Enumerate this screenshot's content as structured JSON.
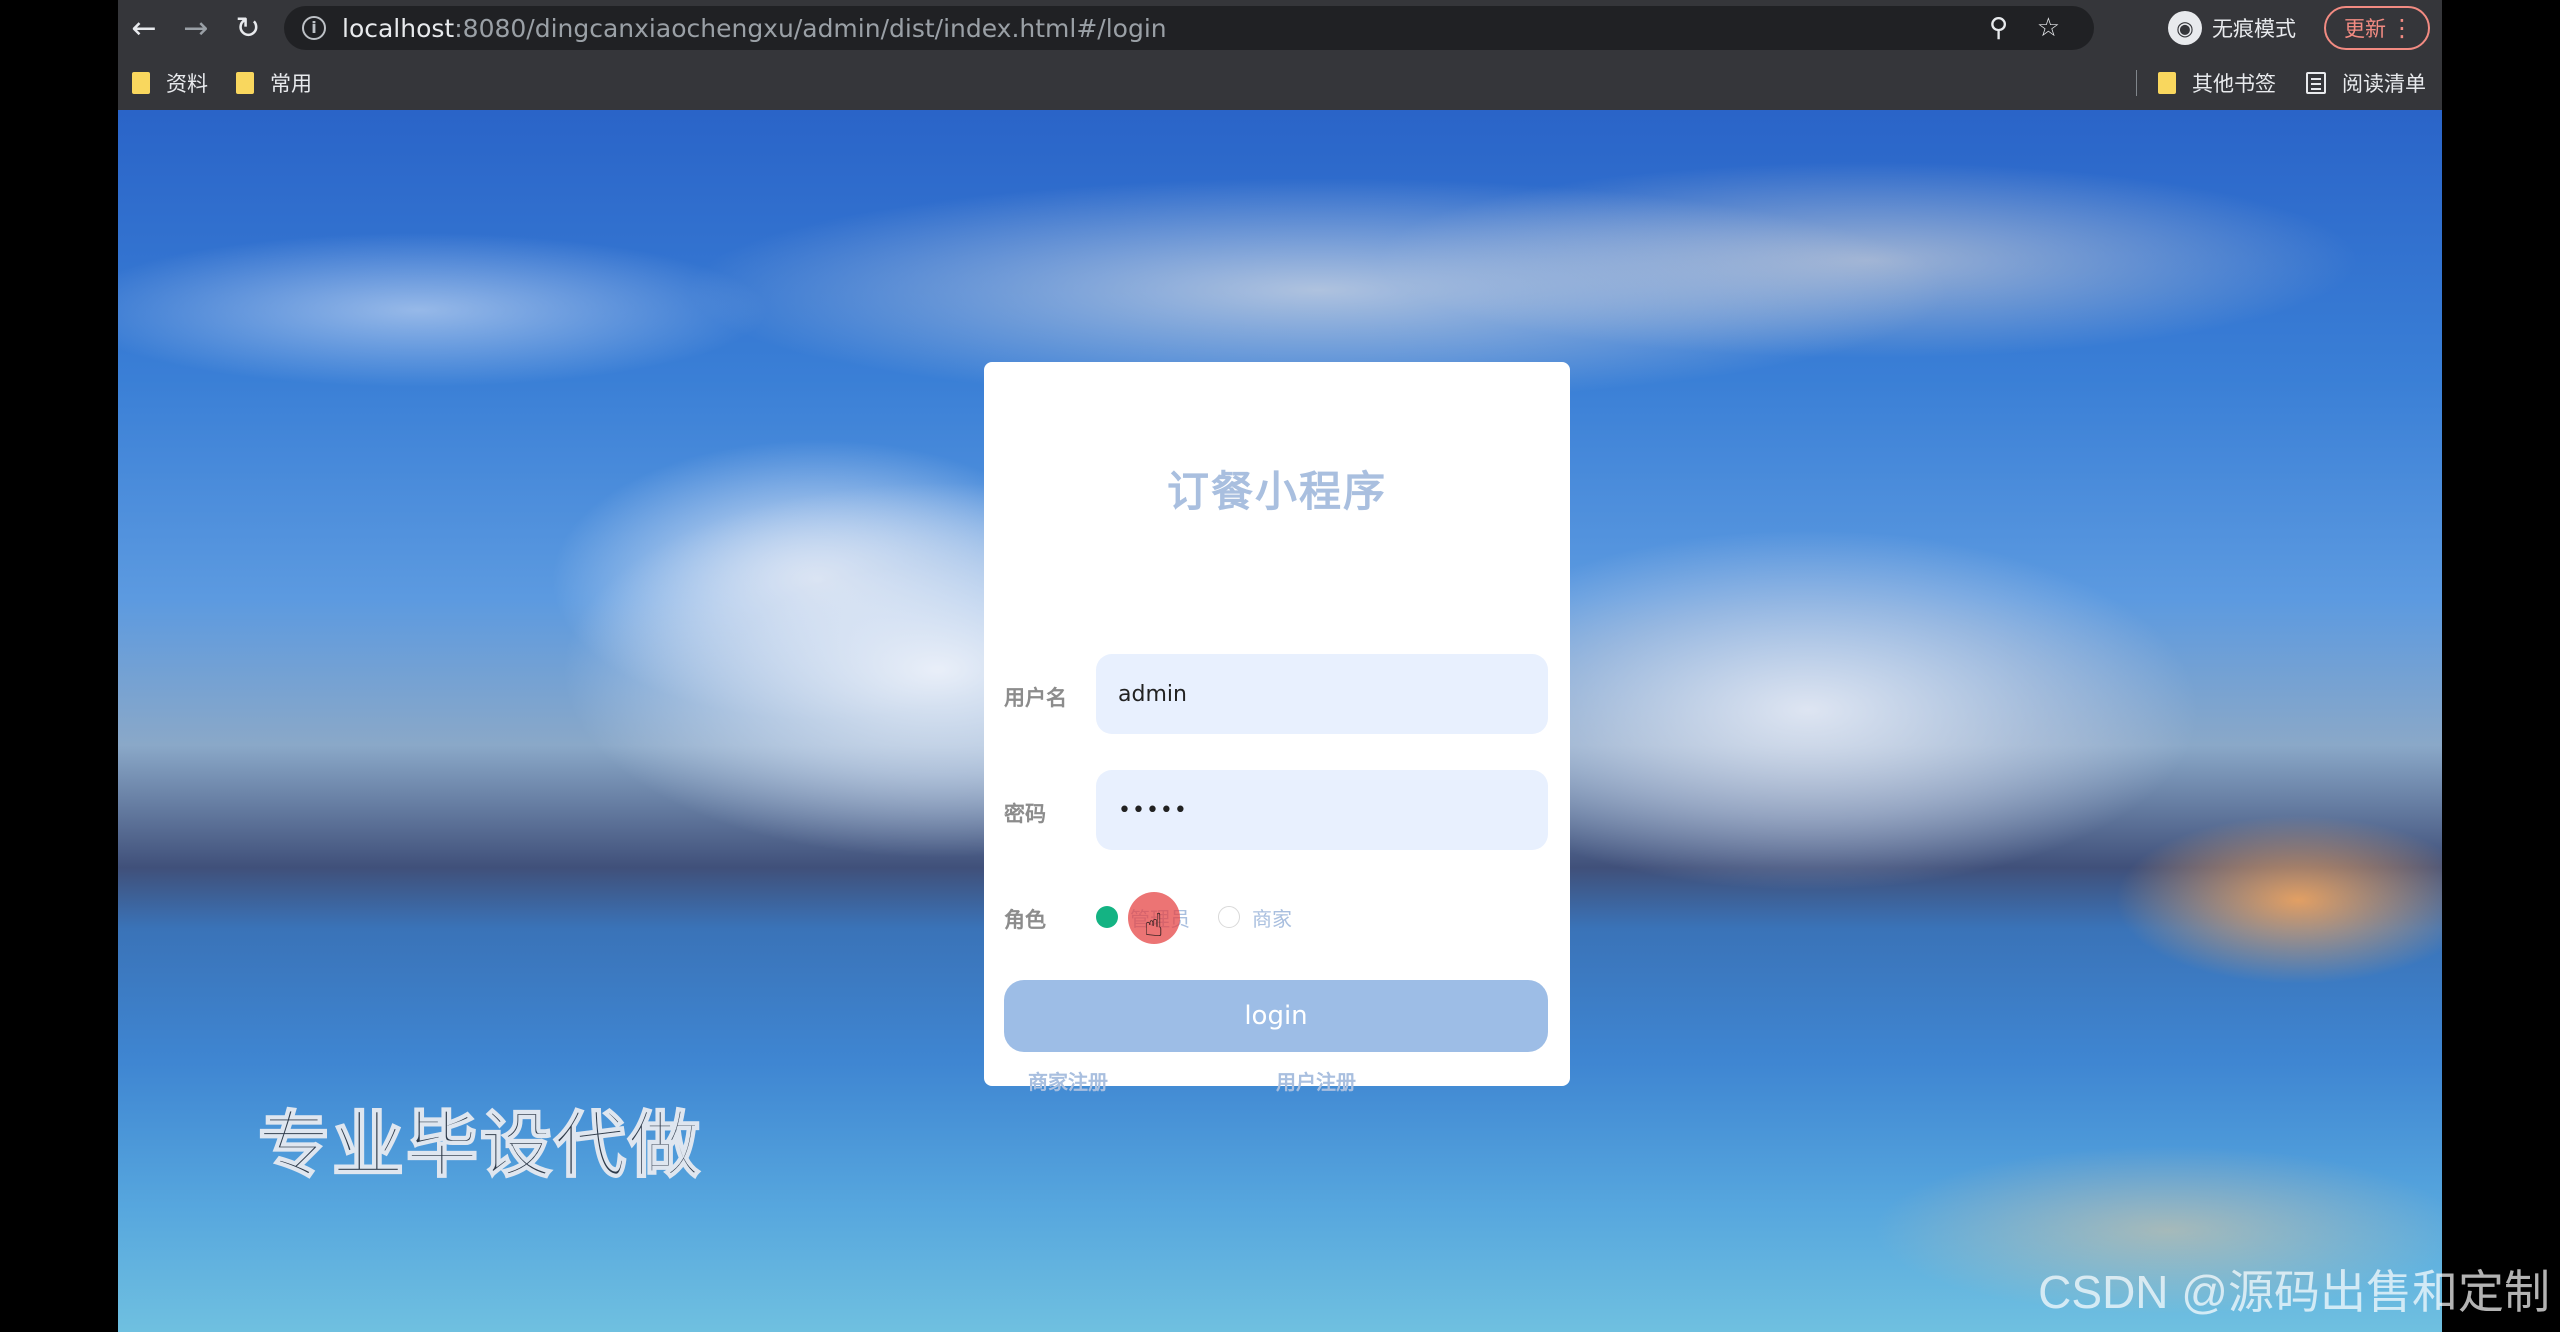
{
  "browser": {
    "url_host": "localhost",
    "url_rest": ":8080/dingcanxiaochengxu/admin/dist/index.html#/login",
    "incognito_label": "无痕模式",
    "update_label": "更新",
    "bookmarks": [
      {
        "label": "资料"
      },
      {
        "label": "常用"
      }
    ],
    "other_bookmarks_label": "其他书签",
    "reading_list_label": "阅读清单"
  },
  "login": {
    "title": "订餐小程序",
    "username_label": "用户名",
    "username_value": "admin",
    "password_label": "密码",
    "password_value": "•••••",
    "role_label": "角色",
    "roles": [
      {
        "label": "管理员",
        "checked": true
      },
      {
        "label": "商家",
        "checked": false
      }
    ],
    "login_button": "login",
    "merchant_register": "商家注册",
    "user_register": "用户注册"
  },
  "overlay": {
    "promo_text": "专业毕设代做",
    "watermark": "CSDN @源码出售和定制"
  },
  "colors": {
    "title": "#a9bfdf",
    "input_bg": "#e8f0fe",
    "button_bg": "#9dbde6",
    "radio_checked": "#14b383",
    "update_accent": "#f28b82"
  }
}
